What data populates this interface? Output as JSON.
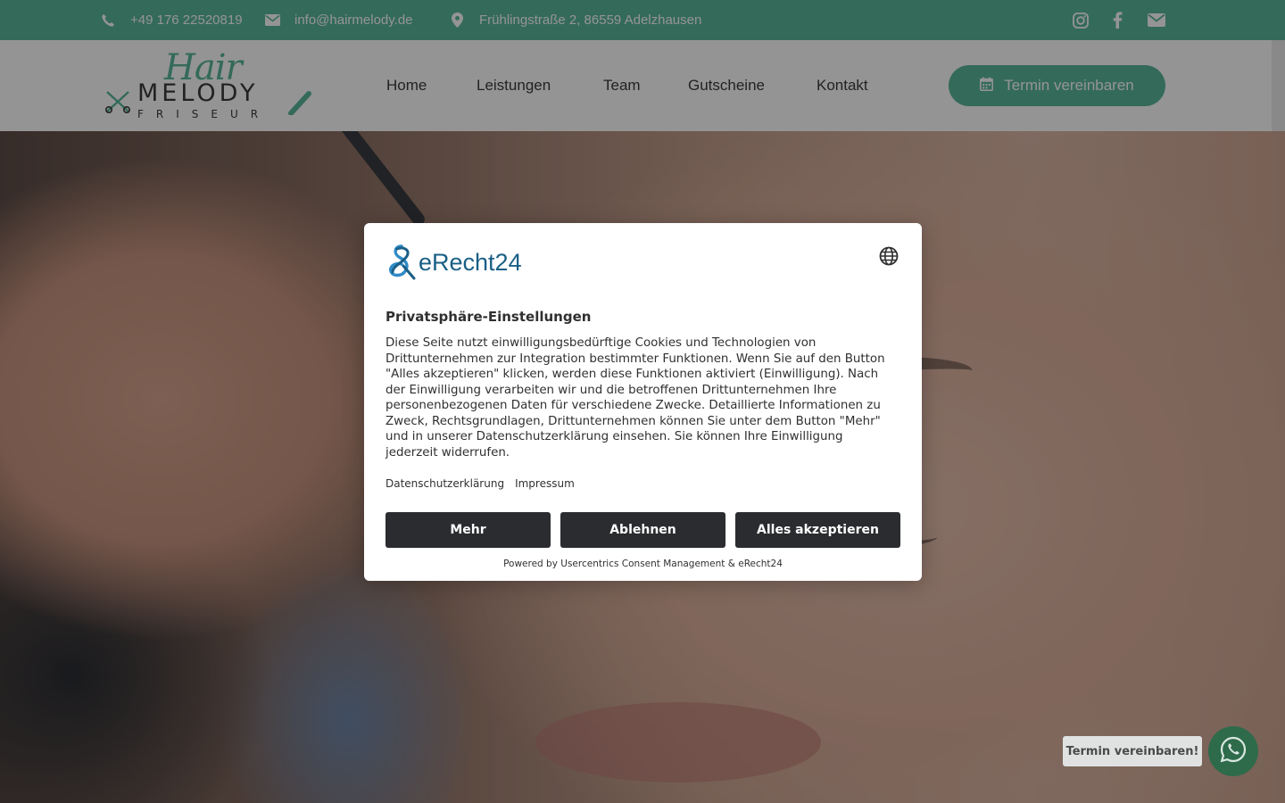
{
  "topbar": {
    "phone": "+49 176 22520819",
    "email": "info@hairmelody.de",
    "address": "Frühlingstraße 2, 86559 Adelzhausen",
    "social_icons": [
      "instagram-icon",
      "facebook-icon",
      "envelope-icon"
    ]
  },
  "logo": {
    "line1": "Hair",
    "line2": "MELODY",
    "line3": "FRISEUR"
  },
  "nav": {
    "items": [
      {
        "label": "Home"
      },
      {
        "label": "Leistungen"
      },
      {
        "label": "Team"
      },
      {
        "label": "Gutscheine"
      },
      {
        "label": "Kontakt"
      }
    ],
    "cta_label": "Termin vereinbaren"
  },
  "consent": {
    "brand": "eRecht24",
    "title": "Privatsphäre-Einstellungen",
    "body": "Diese Seite nutzt einwilligungsbedürftige Cookies und Technologien von Drittunternehmen zur Integration bestimmter Funktionen. Wenn Sie auf den Button \"Alles akzeptieren\" klicken, werden diese Funktionen aktiviert (Einwilligung). Nach der Einwilligung verarbeiten wir und die betroffenen Drittunternehmen Ihre personenbezogenen Daten für verschiedene Zwecke. Detaillierte Informationen zu Zweck, Rechtsgrundlagen, Drittunternehmen können Sie unter dem Button \"Mehr\" und in unserer Datenschutzerklärung einsehen. Sie können Ihre Einwilligung jederzeit widerrufen.",
    "links": {
      "privacy": "Datenschutzerklärung",
      "imprint": "Impressum"
    },
    "buttons": {
      "more": "Mehr",
      "deny": "Ablehnen",
      "accept": "Alles akzeptieren"
    },
    "powered_by": "Powered by Usercentrics Consent Management & eRecht24"
  },
  "whatsapp": {
    "label": "Termin vereinbaren!"
  },
  "colors": {
    "accent": "#5ab79c",
    "brand_blue": "#1a5f86",
    "button_dark": "#2b2c2f",
    "text": "#303030"
  }
}
